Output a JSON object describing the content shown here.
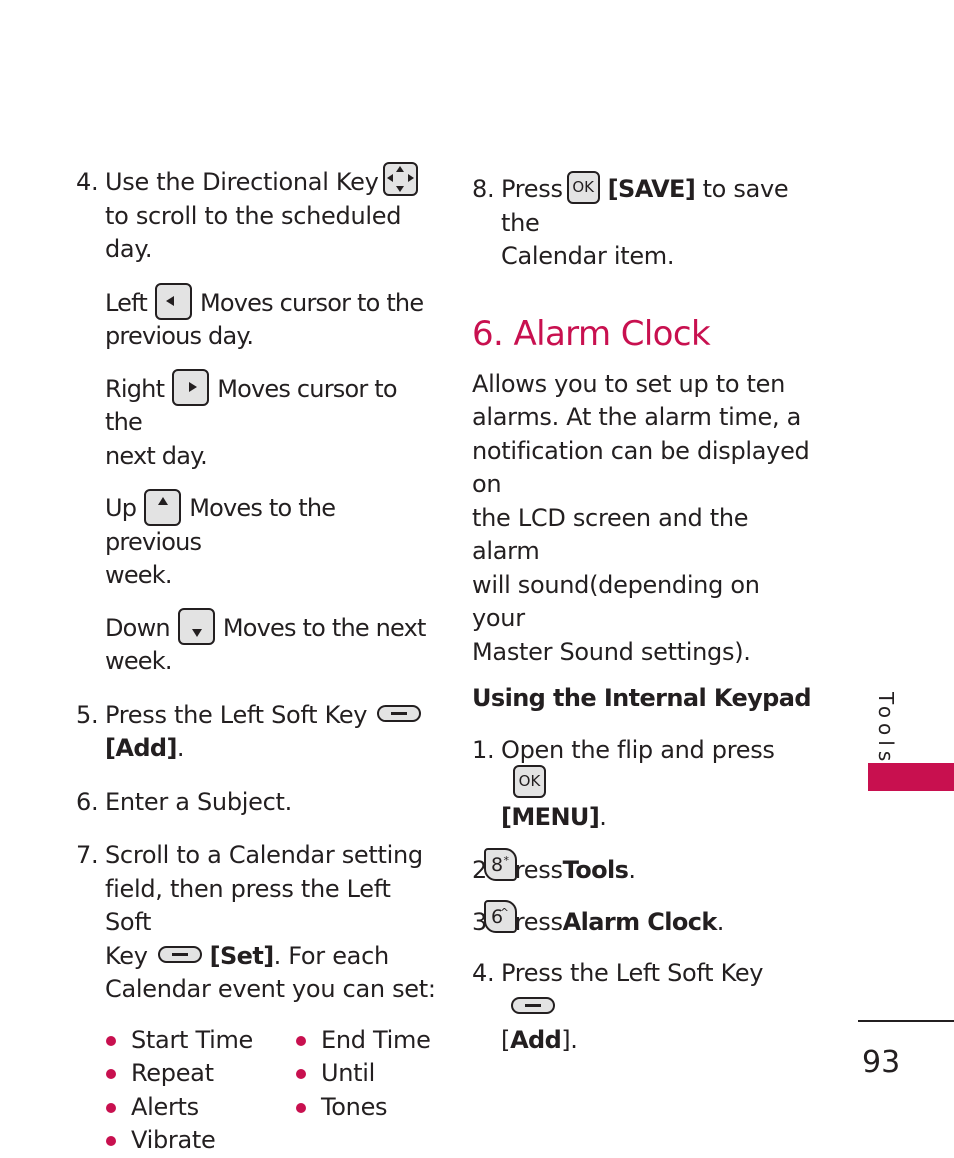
{
  "colors": {
    "accent": "#c8104f",
    "text": "#231f20",
    "key_fill": "#e3e3e3"
  },
  "left_column": {
    "step4": {
      "num": "4.",
      "text_a": "Use the Directional Key",
      "text_b": "to scroll to the scheduled day.",
      "icon": "directional-key-icon",
      "subitems": [
        {
          "label": "Left",
          "icon": "left-arrow-key-icon",
          "desc_a": "Moves cursor to the",
          "desc_b": "previous day."
        },
        {
          "label": "Right",
          "icon": "right-arrow-key-icon",
          "desc_a": "Moves cursor to the",
          "desc_b": "next day."
        },
        {
          "label": "Up",
          "icon": "up-arrow-key-icon",
          "desc_a": "Moves to the previous",
          "desc_b": "week."
        },
        {
          "label": "Down",
          "icon": "down-arrow-key-icon",
          "desc_a": "Moves to the next",
          "desc_b": "week."
        }
      ]
    },
    "step5": {
      "num": "5.",
      "text": "Press the Left Soft Key",
      "icon": "left-soft-key-icon",
      "action": "[Add]",
      "end": "."
    },
    "step6": {
      "num": "6.",
      "text": "Enter a Subject."
    },
    "step7": {
      "num": "7.",
      "text_a": "Scroll to a Calendar setting",
      "text_b": "field, then press the Left Soft",
      "text_c": "Key",
      "icon": "left-soft-key-icon",
      "action": "[Set]",
      "text_d": ". For each",
      "text_e": "Calendar event you can set:"
    },
    "bullets": [
      "Start Time",
      "End Time",
      "Repeat",
      "Until",
      "Alerts",
      "Tones",
      "Vibrate"
    ]
  },
  "right_column": {
    "step8": {
      "num": "8.",
      "text_a": "Press",
      "key_label": "OK",
      "action": "[SAVE]",
      "text_b": "to save the",
      "text_c": "Calendar item."
    },
    "section_title": "6. Alarm Clock",
    "description": "Allows you to set up to ten alarms. At the alarm time, a notification can be displayed on the LCD screen and the alarm will sound(depending on your Master Sound settings).",
    "description_lines": [
      "Allows you to set up to ten",
      "alarms. At the alarm time, a",
      "notification can be displayed on",
      "the LCD screen and the alarm",
      "will sound(depending on your",
      "Master Sound settings)."
    ],
    "subheading": "Using the Internal Keypad",
    "steps": [
      {
        "num": "1.",
        "text": "Open the flip and press",
        "key_label": "OK",
        "action": "[MENU]",
        "end": "."
      },
      {
        "num": "2.",
        "text": "Press",
        "key_label": "8",
        "key_sup": "*",
        "action": "Tools",
        "end": "."
      },
      {
        "num": "3.",
        "text": "Press",
        "key_label": "6",
        "key_sup": "^",
        "action": "Alarm Clock",
        "end": "."
      },
      {
        "num": "4.",
        "text": "Press the Left Soft Key",
        "action_open": "[",
        "action": "Add",
        "action_close": "]",
        "end": "."
      }
    ]
  },
  "side_tab": {
    "label": "Tools"
  },
  "page_number": "93"
}
